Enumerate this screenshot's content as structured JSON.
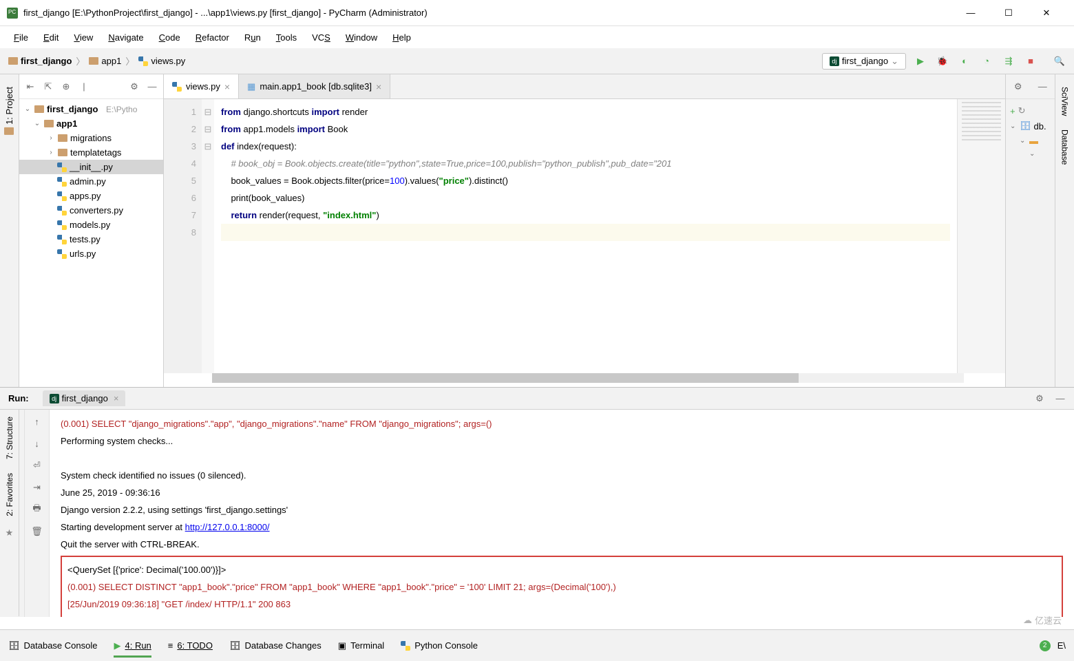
{
  "window": {
    "title": "first_django [E:\\PythonProject\\first_django] - ...\\app1\\views.py [first_django] - PyCharm (Administrator)"
  },
  "menu": [
    "File",
    "Edit",
    "View",
    "Navigate",
    "Code",
    "Refactor",
    "Run",
    "Tools",
    "VCS",
    "Window",
    "Help"
  ],
  "breadcrumb": {
    "p1": "first_django",
    "p2": "app1",
    "p3": "views.py"
  },
  "run_config": {
    "name": "first_django"
  },
  "project_tree": {
    "root": "first_django",
    "root_path": "E:\\Pytho",
    "app1": "app1",
    "migrations": "migrations",
    "templatetags": "templatetags",
    "init": "__init__.py",
    "admin": "admin.py",
    "apps": "apps.py",
    "converters": "converters.py",
    "models": "models.py",
    "tests": "tests.py",
    "urls": "urls.py"
  },
  "editor_tabs": {
    "t1": "views.py",
    "t2": "main.app1_book [db.sqlite3]"
  },
  "code": {
    "l1a": "from",
    "l1b": " django.shortcuts ",
    "l1c": "import",
    "l1d": " render",
    "l2a": "from",
    "l2b": " app1.models ",
    "l2c": "import",
    "l2d": " Book",
    "l3a": "def ",
    "l3b": "index",
    "l3c": "(request):",
    "l4": "    # book_obj = Book.objects.create(title=\"python\",state=True,price=100,publish=\"python_publish\",pub_date=\"201",
    "l5a": "    book_values = Book.objects.filter(",
    "l5b": "price",
    "l5c": "=",
    "l5d": "100",
    "l5e": ").values(",
    "l5f": "\"price\"",
    "l5g": ").distinct()",
    "l6a": "    print",
    "l6b": "(book_values)",
    "l7a": "    return ",
    "l7b": "render(request, ",
    "l7c": "\"index.html\"",
    "l7d": ")",
    "lines": [
      "1",
      "2",
      "3",
      "4",
      "5",
      "6",
      "7",
      "8"
    ]
  },
  "db_panel": {
    "item1": "db."
  },
  "sidebars": {
    "project": "1: Project",
    "structure": "7: Structure",
    "favorites": "2: Favorites",
    "sciview": "SciView",
    "database": "Database"
  },
  "run_panel": {
    "label": "Run:",
    "tab": "first_django"
  },
  "console": {
    "l1": "(0.001) SELECT \"django_migrations\".\"app\", \"django_migrations\".\"name\" FROM \"django_migrations\"; args=()",
    "l2": "Performing system checks...",
    "l3": "System check identified no issues (0 silenced).",
    "l4": "June 25, 2019 - 09:36:16",
    "l5": "Django version 2.2.2, using settings 'first_django.settings'",
    "l6": "Starting development server at ",
    "l6link": "http://127.0.0.1:8000/",
    "l7": "Quit the server with CTRL-BREAK.",
    "b1": "<QuerySet [{'price': Decimal('100.00')}]>",
    "b2": "(0.001) SELECT DISTINCT \"app1_book\".\"price\" FROM \"app1_book\" WHERE \"app1_book\".\"price\" = '100'  LIMIT 21; args=(Decimal('100'),)",
    "b3": "[25/Jun/2019 09:36:18] \"GET /index/ HTTP/1.1\" 200 863"
  },
  "statusbar": {
    "db_console": "Database Console",
    "run": "4: Run",
    "todo": "6: TODO",
    "db_changes": "Database Changes",
    "terminal": "Terminal",
    "py_console": "Python Console",
    "badge": "2",
    "ev": "E\\"
  },
  "watermark": "亿速云"
}
